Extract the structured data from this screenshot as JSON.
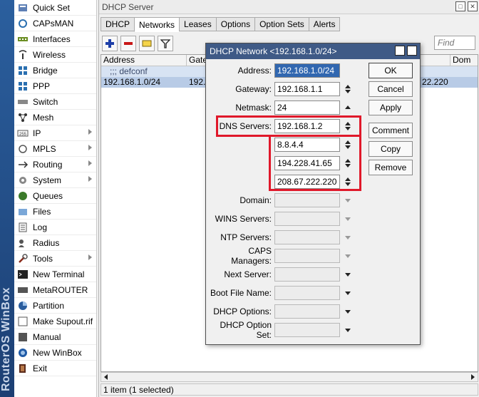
{
  "brand": {
    "text": "RouterOS WinBox"
  },
  "menu": {
    "items": [
      {
        "label": "Quick Set",
        "icon": "quick-set-icon",
        "submenu": false
      },
      {
        "label": "CAPsMAN",
        "icon": "capsman-icon",
        "submenu": false
      },
      {
        "label": "Interfaces",
        "icon": "interfaces-icon",
        "submenu": false
      },
      {
        "label": "Wireless",
        "icon": "wireless-icon",
        "submenu": false
      },
      {
        "label": "Bridge",
        "icon": "bridge-icon",
        "submenu": false
      },
      {
        "label": "PPP",
        "icon": "ppp-icon",
        "submenu": false
      },
      {
        "label": "Switch",
        "icon": "switch-icon",
        "submenu": false
      },
      {
        "label": "Mesh",
        "icon": "mesh-icon",
        "submenu": false
      },
      {
        "label": "IP",
        "icon": "ip-icon",
        "submenu": true
      },
      {
        "label": "MPLS",
        "icon": "mpls-icon",
        "submenu": true
      },
      {
        "label": "Routing",
        "icon": "routing-icon",
        "submenu": true
      },
      {
        "label": "System",
        "icon": "system-icon",
        "submenu": true
      },
      {
        "label": "Queues",
        "icon": "queues-icon",
        "submenu": false
      },
      {
        "label": "Files",
        "icon": "files-icon",
        "submenu": false
      },
      {
        "label": "Log",
        "icon": "log-icon",
        "submenu": false
      },
      {
        "label": "Radius",
        "icon": "radius-icon",
        "submenu": false
      },
      {
        "label": "Tools",
        "icon": "tools-icon",
        "submenu": true
      },
      {
        "label": "New Terminal",
        "icon": "terminal-icon",
        "submenu": false
      },
      {
        "label": "MetaROUTER",
        "icon": "metarouter-icon",
        "submenu": false
      },
      {
        "label": "Partition",
        "icon": "partition-icon",
        "submenu": false
      },
      {
        "label": "Make Supout.rif",
        "icon": "supout-icon",
        "submenu": false
      },
      {
        "label": "Manual",
        "icon": "manual-icon",
        "submenu": false
      },
      {
        "label": "New WinBox",
        "icon": "new-winbox-icon",
        "submenu": false
      },
      {
        "label": "Exit",
        "icon": "exit-icon",
        "submenu": false
      }
    ]
  },
  "dhcp_window": {
    "title": "DHCP Server",
    "tabs": [
      "DHCP",
      "Networks",
      "Leases",
      "Options",
      "Option Sets",
      "Alerts"
    ],
    "active_tab": "Networks",
    "find_placeholder": "Find",
    "columns": [
      "Address",
      "Gate",
      "Dom"
    ],
    "rows": [
      {
        "type": "comment",
        "text": ";;; defconf"
      },
      {
        "type": "data",
        "address": "192.168.1.0/24",
        "gateway": "192.",
        "tail": "22.220"
      }
    ],
    "status": "1 item (1 selected)"
  },
  "dialog": {
    "title": "DHCP Network <192.168.1.0/24>",
    "fields": {
      "address": {
        "label": "Address:",
        "value": "192.168.1.0/24"
      },
      "gateway": {
        "label": "Gateway:",
        "value": "192.168.1.1"
      },
      "netmask": {
        "label": "Netmask:",
        "value": "24"
      },
      "dns": {
        "label": "DNS Servers:",
        "values": [
          "192.168.1.2",
          "8.8.4.4",
          "194.228.41.65",
          "208.67.222.220"
        ]
      },
      "domain": {
        "label": "Domain:",
        "value": ""
      },
      "wins": {
        "label": "WINS Servers:",
        "value": ""
      },
      "ntp": {
        "label": "NTP Servers:",
        "value": ""
      },
      "caps": {
        "label": "CAPS Managers:",
        "value": ""
      },
      "next_server": {
        "label": "Next Server:",
        "value": ""
      },
      "boot_file": {
        "label": "Boot File Name:",
        "value": ""
      },
      "dhcp_options": {
        "label": "DHCP Options:",
        "value": ""
      },
      "dhcp_option_set": {
        "label": "DHCP Option Set:",
        "value": ""
      }
    },
    "buttons": {
      "ok": "OK",
      "cancel": "Cancel",
      "apply": "Apply",
      "comment": "Comment",
      "copy": "Copy",
      "remove": "Remove"
    }
  },
  "colors": {
    "highlight": "#e0182a",
    "selection": "#3167b0",
    "dialog_title": "#3f5a86"
  }
}
